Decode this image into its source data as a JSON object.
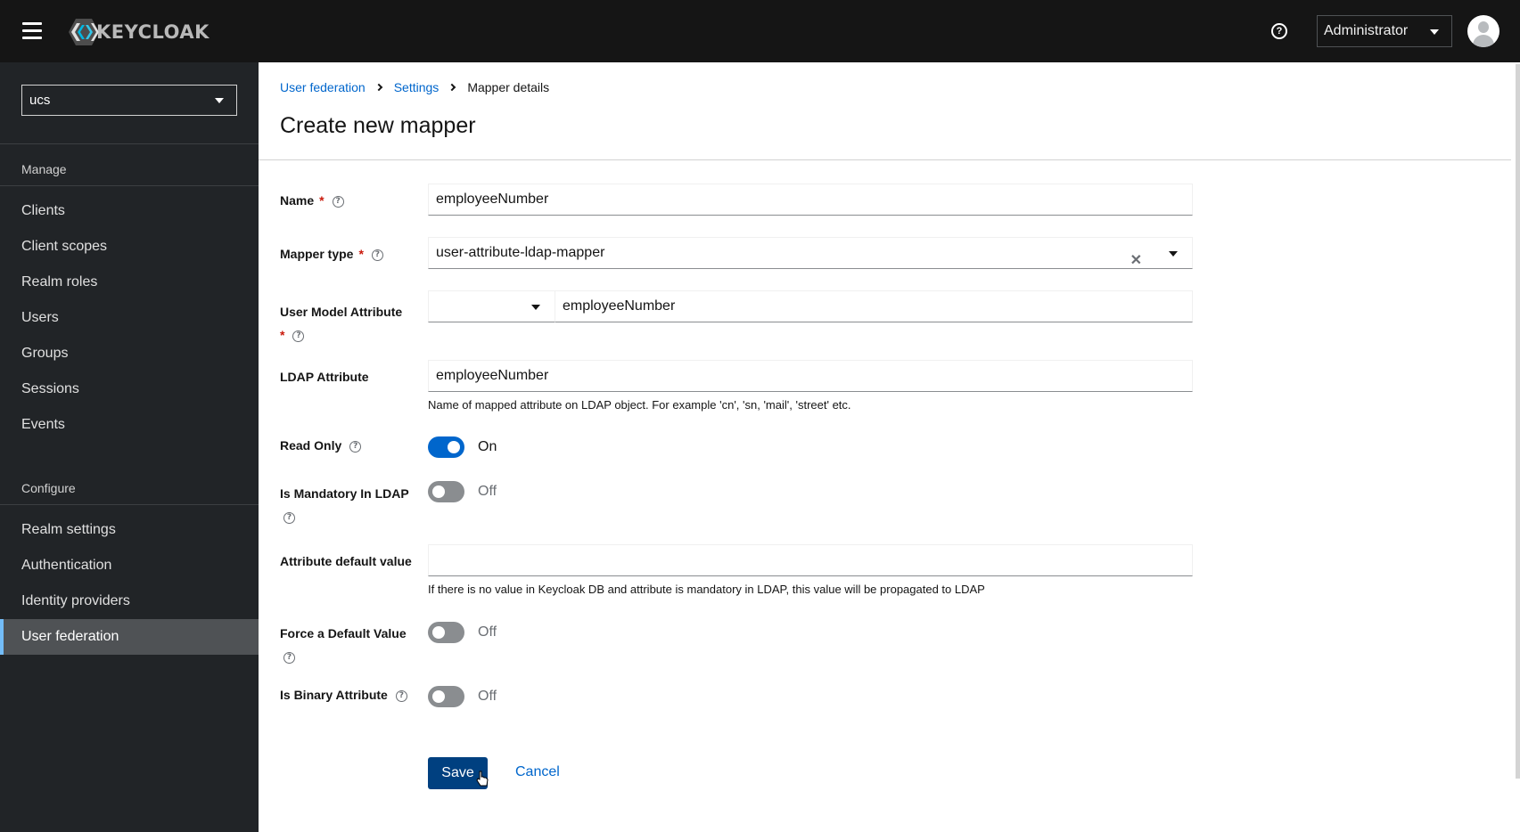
{
  "header": {
    "brand": "KEYCLOAK",
    "user_menu_label": "Administrator"
  },
  "sidebar": {
    "realm": "ucs",
    "sections": [
      {
        "title": "Manage",
        "items": [
          {
            "label": "Clients"
          },
          {
            "label": "Client scopes"
          },
          {
            "label": "Realm roles"
          },
          {
            "label": "Users"
          },
          {
            "label": "Groups"
          },
          {
            "label": "Sessions"
          },
          {
            "label": "Events"
          }
        ]
      },
      {
        "title": "Configure",
        "items": [
          {
            "label": "Realm settings"
          },
          {
            "label": "Authentication"
          },
          {
            "label": "Identity providers"
          },
          {
            "label": "User federation",
            "active": true
          }
        ]
      }
    ]
  },
  "breadcrumb": {
    "items": [
      "User federation",
      "Settings",
      "Mapper details"
    ]
  },
  "page": {
    "title": "Create new mapper"
  },
  "form": {
    "name": {
      "label": "Name",
      "required": "*",
      "value": "employeeNumber"
    },
    "mapper_type": {
      "label": "Mapper type",
      "required": "*",
      "value": "user-attribute-ldap-mapper"
    },
    "user_model_attribute": {
      "label": "User Model Attribute",
      "required": "*",
      "select_value": "",
      "value": "employeeNumber"
    },
    "ldap_attribute": {
      "label": "LDAP Attribute",
      "value": "employeeNumber",
      "helper": "Name of mapped attribute on LDAP object. For example 'cn', 'sn, 'mail', 'street' etc."
    },
    "read_only": {
      "label": "Read Only",
      "state": "On",
      "checked": true
    },
    "is_mandatory_in_ldap": {
      "label": "Is Mandatory In LDAP",
      "state": "Off",
      "checked": false
    },
    "attribute_default_value": {
      "label": "Attribute default value",
      "value": "",
      "helper": "If there is no value in Keycloak DB and attribute is mandatory in LDAP, this value will be propagated to LDAP"
    },
    "force_default_value": {
      "label": "Force a Default Value",
      "state": "Off",
      "checked": false
    },
    "is_binary_attribute": {
      "label": "Is Binary Attribute",
      "state": "Off",
      "checked": false
    }
  },
  "actions": {
    "save_label": "Save",
    "cancel_label": "Cancel"
  },
  "colors": {
    "primary": "#0066cc",
    "save_button": "#004080",
    "masthead": "#151515",
    "sidebar": "#212427",
    "active_nav": "#4f5255",
    "required": "#c9190b"
  }
}
